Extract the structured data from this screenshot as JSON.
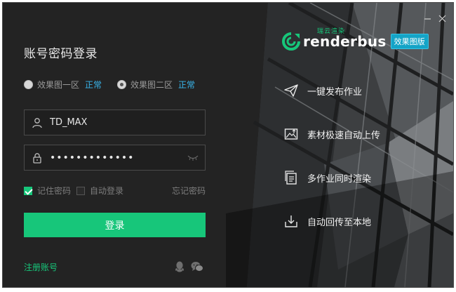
{
  "login": {
    "title": "账号密码登录",
    "regions": [
      {
        "label": "效果图一区",
        "status": "正常",
        "selected": false
      },
      {
        "label": "效果图二区",
        "status": "正常",
        "selected": true
      }
    ],
    "username": {
      "value": "TD_MAX"
    },
    "password": {
      "value": "•••••••••••••"
    },
    "remember_password": {
      "label": "记住密码",
      "checked": true
    },
    "auto_login": {
      "label": "自动登录",
      "checked": false
    },
    "forgot_label": "忘记密码",
    "login_button": "登录",
    "register_link": "注册账号"
  },
  "brand": {
    "sub_label": "瑞云渲染",
    "wordmark": "renderbus",
    "badge": "效果图版"
  },
  "features": [
    {
      "icon": "paper-plane-icon",
      "label": "一键发布作业"
    },
    {
      "icon": "image-upload-icon",
      "label": "素材极速自动上传"
    },
    {
      "icon": "multi-document-icon",
      "label": "多作业同时渲染"
    },
    {
      "icon": "download-tray-icon",
      "label": "自动回传至本地"
    }
  ],
  "colors": {
    "accent": "#17c67a",
    "status_link": "#38b6ec",
    "badge": "#14a4c7",
    "panel_bg": "#232323"
  }
}
